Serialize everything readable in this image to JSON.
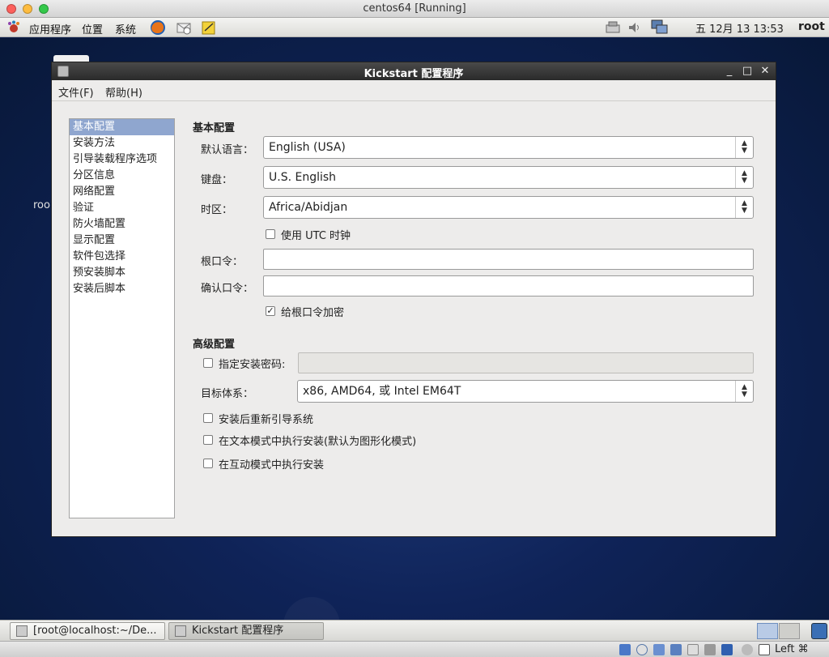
{
  "host": {
    "title": "centos64 [Running]"
  },
  "panel": {
    "menus": [
      "应用程序",
      "位置",
      "系统"
    ],
    "clock": "五 12月 13 13:53",
    "user": "root",
    "icons": [
      "gnome-foot-icon",
      "firefox-icon",
      "mail-icon",
      "notes-icon",
      "network-icon",
      "volume-icon",
      "display-icon"
    ]
  },
  "desktop": {
    "label": "roo"
  },
  "window": {
    "title": "Kickstart 配置程序",
    "menus": [
      "文件(F)",
      "帮助(H)"
    ],
    "sidebar": [
      "基本配置",
      "安装方法",
      "引导装载程序选项",
      "分区信息",
      "网络配置",
      "验证",
      "防火墙配置",
      "显示配置",
      "软件包选择",
      "预安装脚本",
      "安装后脚本"
    ],
    "basic": {
      "title": "基本配置",
      "language_label": "默认语言：",
      "language_value": "English (USA)",
      "keyboard_label": "键盘：",
      "keyboard_value": "U.S. English",
      "timezone_label": "时区：",
      "timezone_value": "Africa/Abidjan",
      "utc_label": "使用 UTC 时钟",
      "rootpw_label": "根口令：",
      "confirm_label": "确认口令：",
      "encrypt_label": "给根口令加密"
    },
    "advanced": {
      "title": "高级配置",
      "installkey_label": "指定安装密码:",
      "arch_label": "目标体系：",
      "arch_value": "x86, AMD64, 或 Intel EM64T",
      "reboot_label": "安装后重新引导系统",
      "textmode_label": "在文本模式中执行安装(默认为图形化模式)",
      "interactive_label": "在互动模式中执行安装"
    }
  },
  "taskbar": {
    "tasks": [
      "[root@localhost:~/De...",
      "Kickstart 配置程序"
    ]
  },
  "statusbar": {
    "hostkey": "Left ⌘"
  }
}
